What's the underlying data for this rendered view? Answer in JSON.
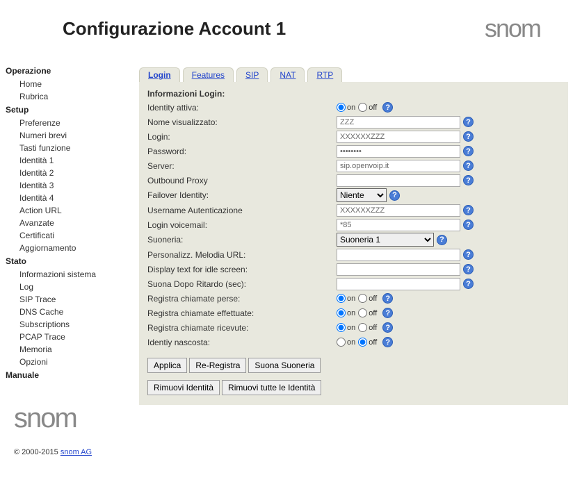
{
  "header": {
    "title": "Configurazione Account 1",
    "logo": "snom"
  },
  "sidebar": {
    "sections": [
      {
        "title": "Operazione",
        "items": [
          "Home",
          "Rubrica"
        ]
      },
      {
        "title": "Setup",
        "items": [
          "Preferenze",
          "Numeri brevi",
          "Tasti funzione",
          "Identità 1",
          "Identità 2",
          "Identità 3",
          "Identità 4",
          "Action URL",
          "Avanzate",
          "Certificati",
          "Aggiornamento"
        ]
      },
      {
        "title": "Stato",
        "items": [
          "Informazioni sistema",
          "Log",
          "SIP Trace",
          "DNS Cache",
          "Subscriptions",
          "PCAP Trace",
          "Memoria",
          "Opzioni"
        ]
      },
      {
        "title": "Manuale",
        "items": []
      }
    ],
    "logo": "snom",
    "copyright_prefix": "© 2000-2015 ",
    "copyright_link": "snom AG"
  },
  "tabs": [
    "Login",
    "Features",
    "SIP",
    "NAT",
    "RTP"
  ],
  "active_tab": 0,
  "panel": {
    "title": "Informazioni Login:",
    "fields": {
      "identity_active": {
        "label": "Identity attiva:",
        "type": "radio",
        "value": "on"
      },
      "display_name": {
        "label": "Nome visualizzato:",
        "type": "text",
        "value": "ZZZ"
      },
      "login": {
        "label": "Login:",
        "type": "text",
        "value": "XXXXXXZZZ"
      },
      "password": {
        "label": "Password:",
        "type": "password",
        "value": "••••••••"
      },
      "server": {
        "label": "Server:",
        "type": "text",
        "value": "sip.openvoip.it"
      },
      "outbound_proxy": {
        "label": "Outbound Proxy",
        "type": "text",
        "value": ""
      },
      "failover": {
        "label": "Failover Identity:",
        "type": "select_narrow",
        "value": "Niente"
      },
      "auth_user": {
        "label": "Username Autenticazione",
        "type": "text",
        "value": "XXXXXXZZZ"
      },
      "voicemail": {
        "label": "Login voicemail:",
        "type": "text",
        "value": "*85"
      },
      "ringtone": {
        "label": "Suoneria:",
        "type": "select_wide",
        "value": "Suoneria 1"
      },
      "melody_url": {
        "label": "Personalizz. Melodia URL:",
        "type": "text",
        "value": ""
      },
      "idle_text": {
        "label": "Display text for idle screen:",
        "type": "text",
        "value": ""
      },
      "ring_delay": {
        "label": "Suona Dopo Ritardo (sec):",
        "type": "text",
        "value": ""
      },
      "log_missed": {
        "label": "Registra chiamate perse:",
        "type": "radio",
        "value": "on"
      },
      "log_dialed": {
        "label": "Registra chiamate effettuate:",
        "type": "radio",
        "value": "on"
      },
      "log_received": {
        "label": "Registra chiamate ricevute:",
        "type": "radio",
        "value": "on"
      },
      "hidden_id": {
        "label": "Identiy nascosta:",
        "type": "radio",
        "value": "off"
      }
    },
    "field_order": [
      "identity_active",
      "display_name",
      "login",
      "password",
      "server",
      "outbound_proxy",
      "failover",
      "auth_user",
      "voicemail",
      "ringtone",
      "melody_url",
      "idle_text",
      "ring_delay",
      "log_missed",
      "log_dialed",
      "log_received",
      "hidden_id"
    ],
    "radio_labels": {
      "on": "on",
      "off": "off"
    },
    "buttons_row1": [
      "Applica",
      "Re-Registra",
      "Suona Suoneria"
    ],
    "buttons_row2": [
      "Rimuovi Identità",
      "Rimuovi tutte le Identità"
    ]
  }
}
